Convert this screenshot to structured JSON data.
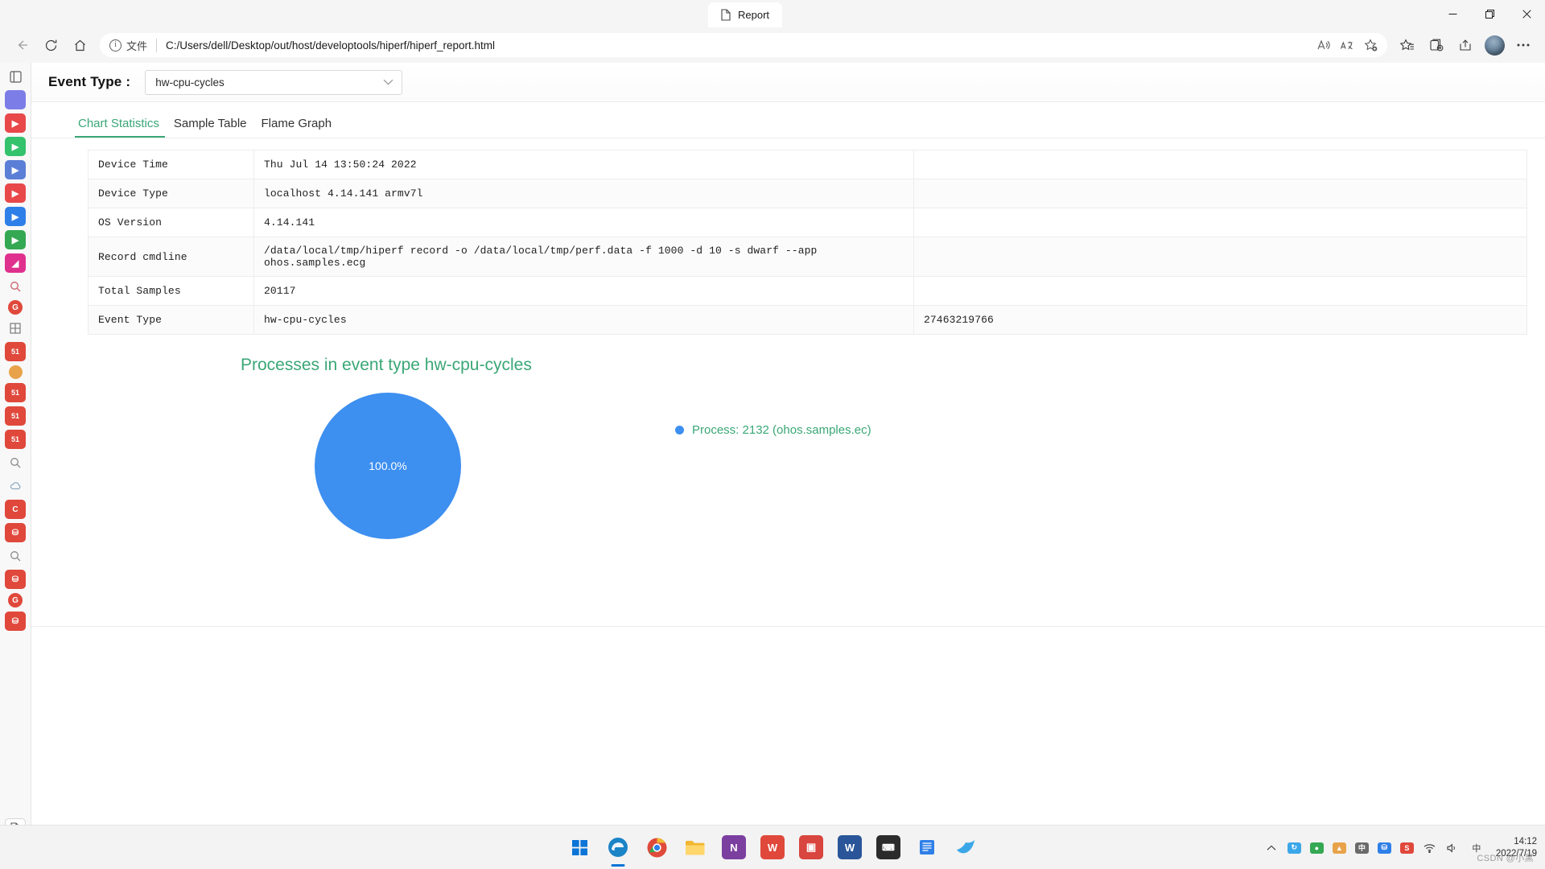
{
  "browser": {
    "tab_title": "Report",
    "tab_icon": "document-icon",
    "window_controls": {
      "minimize": "–",
      "maximize": "❐",
      "close": "✕"
    },
    "nav": {
      "back": "back-arrow-icon",
      "refresh": "refresh-icon",
      "home": "home-icon"
    },
    "address": {
      "site_info_label": "文件",
      "info_glyph": "i",
      "url": "C:/Users/dell/Desktop/out/host/developtools/hiperf/hiperf_report.html"
    },
    "address_actions": [
      "read-aloud-icon",
      "translate-icon",
      "add-favorite-icon"
    ],
    "toolbar_actions": [
      "favorites-icon",
      "collections-icon",
      "share-icon",
      "profile-avatar",
      "settings-more-icon"
    ]
  },
  "sidebar": {
    "items": [
      {
        "name": "app-tile-1",
        "glyph": "",
        "color": "#7d7de8"
      },
      {
        "name": "app-tile-2",
        "glyph": "▶",
        "color": "#e8484a"
      },
      {
        "name": "app-tile-3",
        "glyph": "▶",
        "color": "#34c26d"
      },
      {
        "name": "app-tile-4",
        "glyph": "▶",
        "color": "#5b7fd6"
      },
      {
        "name": "app-tile-5",
        "glyph": "▶",
        "color": "#e8484a"
      },
      {
        "name": "app-tile-6",
        "glyph": "▶",
        "color": "#2f7fe8"
      },
      {
        "name": "app-tile-7",
        "glyph": "▶",
        "color": "#34a853"
      },
      {
        "name": "app-tile-8",
        "glyph": "◤",
        "color": "#e0308e"
      },
      {
        "name": "search-icon",
        "glyph": "⌕",
        "color": ""
      },
      {
        "name": "globe-icon",
        "glyph": "Ⓖ",
        "color": "#e0483b"
      },
      {
        "name": "grid-icon",
        "glyph": "⊞",
        "color": ""
      },
      {
        "name": "app-tile-9",
        "glyph": "51",
        "color": "#e0483b"
      },
      {
        "name": "sphere-icon",
        "glyph": "●",
        "color": "#e8a34a"
      },
      {
        "name": "app-tile-10",
        "glyph": "51",
        "color": "#e0483b"
      },
      {
        "name": "app-tile-11",
        "glyph": "51",
        "color": "#e0483b"
      },
      {
        "name": "app-tile-12",
        "glyph": "51",
        "color": "#e0483b"
      },
      {
        "name": "search-icon-2",
        "glyph": "⌕",
        "color": ""
      },
      {
        "name": "cloud-icon",
        "glyph": "☁",
        "color": ""
      },
      {
        "name": "app-tile-13",
        "glyph": "C",
        "color": "#e0483b"
      },
      {
        "name": "app-tile-14",
        "glyph": "⛁",
        "color": "#e0483b"
      },
      {
        "name": "search-icon-3",
        "glyph": "⌕",
        "color": ""
      },
      {
        "name": "app-tile-15",
        "glyph": "⛁",
        "color": "#e0483b"
      },
      {
        "name": "app-tile-16",
        "glyph": "Ⓖ",
        "color": "#e0483b"
      },
      {
        "name": "app-tile-17",
        "glyph": "⛁",
        "color": "#e0483b"
      },
      {
        "name": "document-icon",
        "glyph": "❐",
        "color": ""
      },
      {
        "name": "add-icon",
        "glyph": "＋",
        "color": ""
      }
    ]
  },
  "report": {
    "event_type": {
      "label": "Event Type :",
      "selected": "hw-cpu-cycles",
      "options": [
        "hw-cpu-cycles"
      ]
    },
    "tabs": [
      {
        "label": "Chart Statistics",
        "active": true
      },
      {
        "label": "Sample Table",
        "active": false
      },
      {
        "label": "Flame Graph",
        "active": false
      }
    ],
    "info_rows": [
      {
        "key": "Device Time",
        "value": "Thu Jul 14 13:50:24 2022",
        "extra": ""
      },
      {
        "key": "Device Type",
        "value": "localhost 4.14.141 armv7l",
        "extra": ""
      },
      {
        "key": "OS Version",
        "value": "4.14.141",
        "extra": ""
      },
      {
        "key": "Record cmdline",
        "value": "/data/local/tmp/hiperf record -o /data/local/tmp/perf.data -f 1000 -d 10 -s dwarf --app ohos.samples.ecg",
        "extra": ""
      },
      {
        "key": "Total Samples",
        "value": "20117",
        "extra": ""
      },
      {
        "key": "Event Type",
        "value": "hw-cpu-cycles",
        "extra": "27463219766"
      }
    ]
  },
  "chart_data": {
    "type": "pie",
    "title": "Processes in event type hw-cpu-cycles",
    "categories": [
      "Process: 2132 (ohos.samples.ec)"
    ],
    "values": [
      100.0
    ],
    "labels": [
      "100.0%"
    ],
    "colors": [
      "#3d8ff0"
    ],
    "legend_position": "right",
    "accent_color": "#3aa776"
  },
  "taskbar": {
    "apps": [
      {
        "name": "start-button",
        "glyph": "⊞",
        "color": "#0a74d8"
      },
      {
        "name": "edge-icon",
        "glyph": "e",
        "color": "#1b84c7",
        "active": true
      },
      {
        "name": "chrome-icon",
        "glyph": "●",
        "color": "#e04a3b"
      },
      {
        "name": "file-explorer-icon",
        "glyph": "▤",
        "color": "#f2b731"
      },
      {
        "name": "onenote-icon",
        "glyph": "N",
        "color": "#7b3fa0"
      },
      {
        "name": "wps-icon",
        "glyph": "W",
        "color": "#e0483b"
      },
      {
        "name": "app-icon-7",
        "glyph": "▣",
        "color": "#d8463f"
      },
      {
        "name": "word-icon",
        "glyph": "W",
        "color": "#2a5699"
      },
      {
        "name": "terminal-icon",
        "glyph": "⌨",
        "color": "#2b2b2b"
      },
      {
        "name": "text-editor-icon",
        "glyph": "≡",
        "color": "#2f7fe8"
      },
      {
        "name": "app-icon-11",
        "glyph": "➤",
        "color": "#3ba7e8"
      }
    ],
    "tray": {
      "show_hidden": "⌃",
      "items": [
        "sync-icon",
        "app-tray-icon",
        "shield-icon",
        "ime-icon",
        "app-tray-icon-2",
        "network-icon",
        "volume-icon"
      ],
      "ime_label": "中",
      "time": "14:12",
      "date": "2022/7/19"
    },
    "watermark": "CSDN @小黑"
  }
}
